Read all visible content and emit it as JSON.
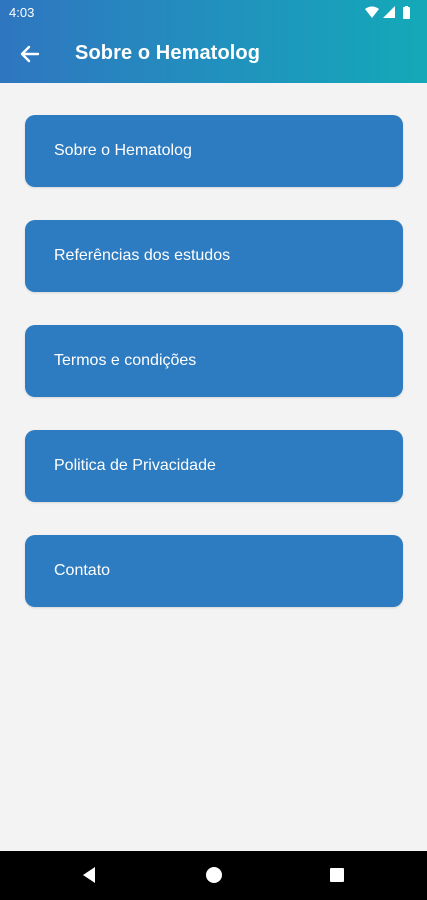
{
  "status_bar": {
    "time": "4:03",
    "icons": [
      "wifi-icon",
      "signal-icon",
      "battery-icon"
    ]
  },
  "app_bar": {
    "back_icon": "arrow-left-icon",
    "title": "Sobre o Hematolog",
    "gradient_colors": [
      "#2f76c0",
      "#13a9b8"
    ]
  },
  "menu": {
    "items": [
      {
        "label": "Sobre o Hematolog"
      },
      {
        "label": "Referências dos estudos"
      },
      {
        "label": "Termos e condições"
      },
      {
        "label": "Politica de Privacidade"
      },
      {
        "label": "Contato"
      }
    ],
    "item_color": "#2d7bc0"
  },
  "nav_bar": {
    "icons": [
      "back-triangle-icon",
      "home-circle-icon",
      "recents-square-icon"
    ]
  }
}
